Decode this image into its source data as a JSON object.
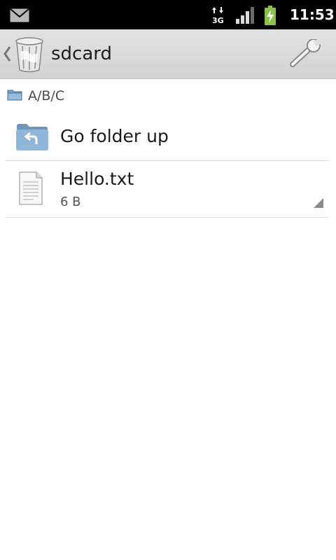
{
  "status_bar": {
    "time": "11:53",
    "network_label": "3G",
    "icons": [
      "mail-icon",
      "network-3g-icon",
      "signal-icon",
      "battery-charging-icon"
    ]
  },
  "action_bar": {
    "title": "sdcard",
    "icons": [
      "back-chevron-icon",
      "trash-bin-icon",
      "wrench-icon"
    ]
  },
  "path_bar": {
    "path": "A/B/C",
    "icon": "folder-icon"
  },
  "list": {
    "items": [
      {
        "name": "Go folder up",
        "icon": "folder-up-icon"
      },
      {
        "name": "Hello.txt",
        "size": "6 B",
        "icon": "text-file-icon"
      }
    ]
  },
  "colors": {
    "status_bar": "#000000",
    "action_bar": "#d9d9d9",
    "battery": "#8bc34a",
    "folder": "#7ba3c7"
  }
}
